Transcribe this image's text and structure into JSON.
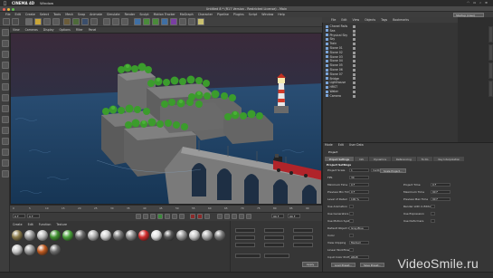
{
  "mac_menubar": {
    "app_name": "CINEMA 4D",
    "window_menu": "Window"
  },
  "window": {
    "title": "Untitled 8 * (R17 Version - Restricted License) - Main"
  },
  "app_menu": [
    "File",
    "Edit",
    "Create",
    "Select",
    "Tools",
    "Mesh",
    "Snap",
    "Animate",
    "Simulate",
    "Render",
    "Sculpt",
    "Motion Tracker",
    "MoGraph",
    "Character",
    "Pipeline",
    "Plugins",
    "Script",
    "Window",
    "Help"
  ],
  "layout": {
    "label": "Layout:",
    "value": "Startup (User)"
  },
  "viewport_menu": [
    "View",
    "Cameras",
    "Display",
    "Options",
    "Filter",
    "Panel"
  ],
  "timeline": {
    "ticks": [
      "0",
      "5",
      "10",
      "15",
      "20",
      "25",
      "30",
      "35",
      "40",
      "45",
      "50",
      "55",
      "60",
      "65",
      "70",
      "75",
      "80",
      "85",
      "90"
    ]
  },
  "playback": {
    "start": "0 F",
    "current": "0 F",
    "end": "90 F",
    "end2": "90 F"
  },
  "material_menu": [
    "Create",
    "Edit",
    "Function",
    "Texture"
  ],
  "materials": {
    "row1_colors": [
      "#8a7a4a",
      "#9a9a9a",
      "#bdbdbd",
      "#3f8f2f",
      "#4aa33a",
      "#6a6a6a",
      "#b0b0b0",
      "#d0d0d0",
      "#777777",
      "#8c8c8c",
      "#d02a2a",
      "#e0e0e0",
      "#555555",
      "#999999",
      "#c8c8c8",
      "#aaaaaa",
      "#7a7a7a"
    ],
    "row2_colors": [
      "#c9c9c9",
      "#9a9a9a",
      "#c05a20",
      "#6d6d6d"
    ]
  },
  "coords": {
    "apply_label": "Apply"
  },
  "object_manager": {
    "menu": [
      "File",
      "Edit",
      "View",
      "Objects",
      "Tags",
      "Bookmarks"
    ],
    "objects": [
      "Chanel Rails",
      "Sea",
      "Physical Sky",
      "Sky",
      "Train",
      "Stone 01",
      "Stone 02",
      "Stone 03",
      "Stone 04",
      "Stone 05",
      "Stone 06",
      "Stone 07",
      "Bridge",
      "Lighthouse",
      "HRST",
      "Water",
      "Camera"
    ]
  },
  "attribute_manager": {
    "menu": [
      "Mode",
      "Edit",
      "User Data"
    ],
    "header": "Project",
    "tabs": [
      "Project Settings",
      "Info",
      "Dynamics",
      "Referencing",
      "To Do",
      "Key Interpolation"
    ],
    "section_title": "Project Settings",
    "rows_left": [
      {
        "label": "Project Scale",
        "value": "1",
        "unit": "Centimeters"
      },
      {
        "label": "FPS",
        "value": "30"
      },
      {
        "label": "Minimum Time",
        "value": "0 F"
      },
      {
        "label": "Preview Min Time",
        "value": "0 F"
      },
      {
        "label": "Level of Detail",
        "value": "100 %"
      },
      {
        "label": "Use Animation"
      },
      {
        "label": "Use Generators"
      },
      {
        "label": "Use Motion System"
      },
      {
        "label": "Default Object Color",
        "value": "Gray-Blue"
      },
      {
        "label": "Color"
      },
      {
        "label": "View Clipping",
        "value": "Medium"
      },
      {
        "label": "Linear Workflow"
      },
      {
        "label": "Input Color Profile",
        "value": "sRGB"
      }
    ],
    "rows_right": [
      {
        "label": "Project Time",
        "value": "0 F"
      },
      {
        "label": "Maximum Time",
        "value": "90 F"
      },
      {
        "label": "Preview Max Time",
        "value": "90 F"
      },
      {
        "label": "Render LOD in Editor"
      },
      {
        "label": "Use Expression"
      },
      {
        "label": "Use Deformers"
      }
    ],
    "buttons": [
      "Load Preset...",
      "Save Preset..."
    ],
    "scale_button": "Scale Project..."
  },
  "watermark": "VideoSmile.ru"
}
